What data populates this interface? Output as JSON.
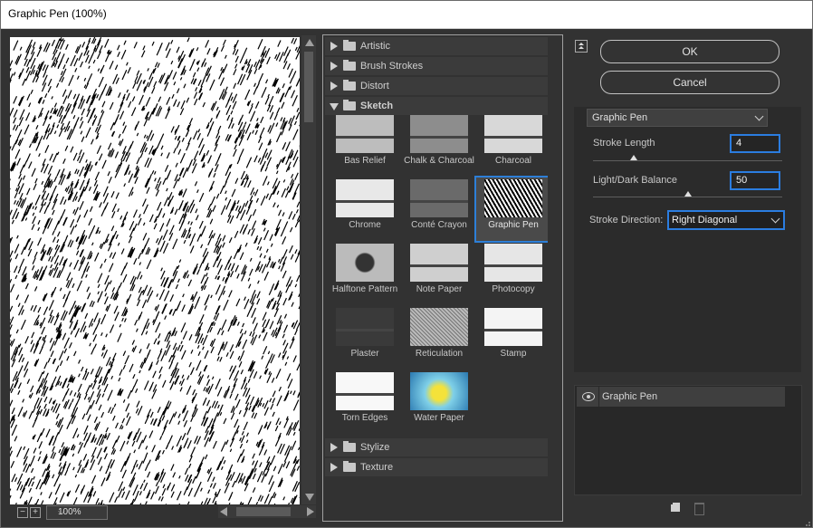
{
  "window": {
    "title": "Graphic Pen (100%)"
  },
  "preview": {
    "zoom": "100%",
    "zoom_out_label": "−",
    "zoom_in_label": "+"
  },
  "gallery": {
    "folders_top": [
      {
        "label": "Artistic",
        "expanded": false
      },
      {
        "label": "Brush Strokes",
        "expanded": false
      },
      {
        "label": "Distort",
        "expanded": false
      },
      {
        "label": "Sketch",
        "expanded": true
      }
    ],
    "sketch_filters": [
      {
        "label": "Bas Relief",
        "selected": false
      },
      {
        "label": "Chalk & Charcoal",
        "selected": false
      },
      {
        "label": "Charcoal",
        "selected": false
      },
      {
        "label": "Chrome",
        "selected": false
      },
      {
        "label": "Conté Crayon",
        "selected": false
      },
      {
        "label": "Graphic Pen",
        "selected": true
      },
      {
        "label": "Halftone Pattern",
        "selected": false
      },
      {
        "label": "Note Paper",
        "selected": false
      },
      {
        "label": "Photocopy",
        "selected": false
      },
      {
        "label": "Plaster",
        "selected": false
      },
      {
        "label": "Reticulation",
        "selected": false
      },
      {
        "label": "Stamp",
        "selected": false
      },
      {
        "label": "Torn Edges",
        "selected": false
      },
      {
        "label": "Water Paper",
        "selected": false
      }
    ],
    "folders_bottom": [
      {
        "label": "Stylize",
        "expanded": false
      },
      {
        "label": "Texture",
        "expanded": false
      }
    ]
  },
  "buttons": {
    "ok": "OK",
    "cancel": "Cancel"
  },
  "settings": {
    "filter_select": "Graphic Pen",
    "stroke_length": {
      "label": "Stroke Length",
      "value": "4",
      "min": 1,
      "max": 15,
      "level": 4
    },
    "light_dark_balance": {
      "label": "Light/Dark Balance",
      "value": "50",
      "min": 0,
      "max": 100,
      "level": 50
    },
    "stroke_direction": {
      "label": "Stroke Direction:",
      "value": "Right Diagonal"
    }
  },
  "layers": [
    {
      "label": "Graphic Pen",
      "visible": true
    }
  ],
  "colors": {
    "accent": "#2b7de0",
    "panel": "#323232",
    "dark_panel": "#2b2b2b"
  }
}
